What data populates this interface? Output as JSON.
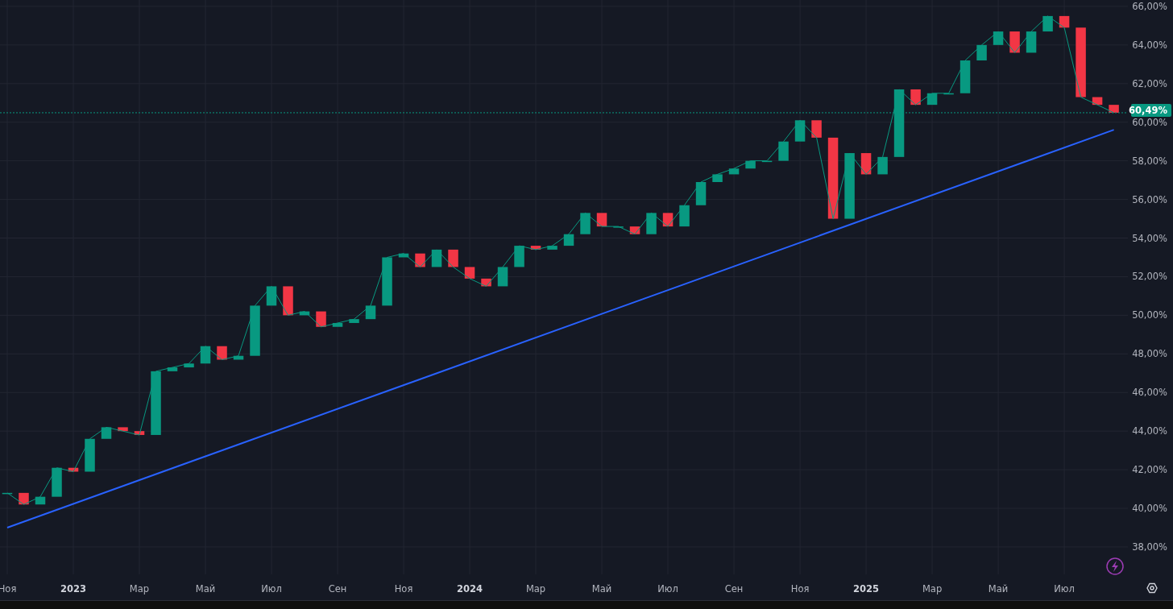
{
  "chart": {
    "chart_data": {
      "type": "line",
      "grid": true,
      "ylim": [
        36.58,
        66.33
      ],
      "categories": [
        "Ноя",
        null,
        null,
        null,
        "2023",
        null,
        null,
        null,
        "Мар",
        null,
        null,
        null,
        "Май",
        null,
        null,
        null,
        "Июл",
        null,
        null,
        null,
        "Сен",
        null,
        null,
        null,
        "Ноя",
        null,
        null,
        null,
        "2024",
        null,
        null,
        null,
        "Мар",
        null,
        null,
        null,
        "Май",
        null,
        null,
        null,
        "Июл",
        null,
        null,
        null,
        "Сен",
        null,
        null,
        null,
        "Ноя",
        null,
        null,
        null,
        "2025",
        null,
        null,
        null,
        "Мар",
        null,
        null,
        null,
        "Май",
        null,
        null,
        null,
        "Июл",
        null,
        null,
        null
      ],
      "series": [
        {
          "color": "#089981",
          "values": [
            40.8,
            40.2,
            40.6,
            42.1,
            41.9,
            43.6,
            44.2,
            44.0,
            43.8,
            47.1,
            47.3,
            47.5,
            48.4,
            47.7,
            47.9,
            50.5,
            51.5,
            50.0,
            50.2,
            49.4,
            49.6,
            49.8,
            50.5,
            53.0,
            53.2,
            52.5,
            53.4,
            52.5,
            51.9,
            51.5,
            52.5,
            53.6,
            53.4,
            53.6,
            54.2,
            55.3,
            54.6,
            54.6,
            54.2,
            55.3,
            54.6,
            55.7,
            56.9,
            57.3,
            57.6,
            58.0,
            58.0,
            59.0,
            60.1,
            59.2,
            55.0,
            58.4,
            57.3,
            58.2,
            61.7,
            60.9,
            61.5,
            61.5,
            63.2,
            64.0,
            64.7,
            63.6,
            64.7,
            65.5,
            64.9,
            61.3,
            60.9,
            60.49
          ]
        },
        {
          "color": "#2962ff",
          "values": [
            39.0,
            null,
            null,
            null,
            null,
            null,
            null,
            null,
            null,
            null,
            null,
            null,
            null,
            null,
            null,
            null,
            null,
            null,
            null,
            null,
            null,
            null,
            null,
            null,
            null,
            null,
            null,
            null,
            null,
            null,
            null,
            null,
            null,
            null,
            null,
            null,
            null,
            null,
            null,
            null,
            null,
            null,
            null,
            null,
            null,
            null,
            null,
            null,
            null,
            null,
            null,
            null,
            null,
            null,
            null,
            null,
            null,
            null,
            null,
            null,
            null,
            null,
            null,
            null,
            null,
            null,
            null,
            59.61
          ]
        }
      ],
      "yticks": [
        {
          "value": 38,
          "label": "38,00%"
        },
        {
          "value": 40,
          "label": "40,00%"
        },
        {
          "value": 42,
          "label": "42,00%"
        },
        {
          "value": 44,
          "label": "44,00%"
        },
        {
          "value": 46,
          "label": "46,00%"
        },
        {
          "value": 48,
          "label": "48,00%"
        },
        {
          "value": 50,
          "label": "50,00%"
        },
        {
          "value": 52,
          "label": "52,00%"
        },
        {
          "value": 54,
          "label": "54,00%"
        },
        {
          "value": 56,
          "label": "56,00%"
        },
        {
          "value": 58,
          "label": "58,00%"
        },
        {
          "value": 60,
          "label": "60,00%"
        },
        {
          "value": 62,
          "label": "62,00%"
        },
        {
          "value": 64,
          "label": "64,00%"
        },
        {
          "value": 66,
          "label": "66,00%"
        }
      ],
      "ref_lines": [
        {
          "axis": "y",
          "value": 60.49,
          "label": "60,49%",
          "color": "#089981"
        }
      ]
    }
  }
}
